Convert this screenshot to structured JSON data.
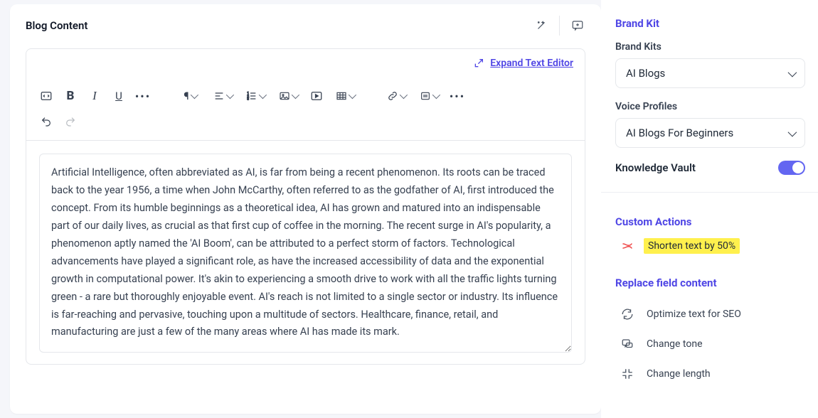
{
  "editor": {
    "title": "Blog Content",
    "expand_label": "Expand Text Editor",
    "content": "Artificial Intelligence, often abbreviated as AI, is far from being a recent phenomenon. Its roots can be traced back to the year 1956, a time when John McCarthy, often referred to as the godfather of AI, first introduced the concept. From its humble beginnings as a theoretical idea, AI has grown and matured into an indispensable part of our daily lives, as crucial as that first cup of coffee in the morning. The recent surge in AI's popularity, a phenomenon aptly named the 'AI Boom', can be attributed to a perfect storm of factors. Technological advancements have played a significant role, as have the increased accessibility of data and the exponential growth in computational power. It's akin to experiencing a smooth drive to work with all the traffic lights turning green - a rare but thoroughly enjoyable event. AI's reach is not limited to a single sector or industry. Its influence is far-reaching and pervasive, touching upon a multitude of sectors. Healthcare, finance, retail, and manufacturing are just a few of the many areas where AI has made its mark."
  },
  "sidebar": {
    "brand_kit_title": "Brand Kit",
    "brand_kits_label": "Brand Kits",
    "brand_kits_value": "AI Blogs",
    "voice_profiles_label": "Voice Profiles",
    "voice_profiles_value": "AI Blogs For Beginners",
    "knowledge_vault_label": "Knowledge Vault",
    "knowledge_vault_on": true,
    "custom_actions_title": "Custom Actions",
    "custom_action_label": "Shorten text by 50%",
    "replace_title": "Replace field content",
    "actions": [
      {
        "label": "Optimize text for SEO",
        "icon": "refresh-icon"
      },
      {
        "label": "Change tone",
        "icon": "chat-icon"
      },
      {
        "label": "Change length",
        "icon": "contract-icon"
      }
    ]
  }
}
